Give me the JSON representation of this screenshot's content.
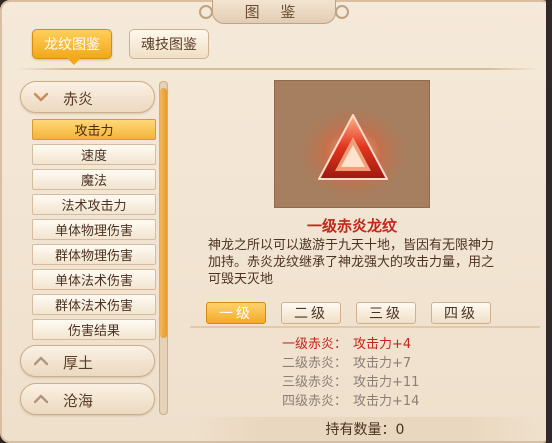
{
  "window": {
    "title": "图 鉴"
  },
  "tabs": [
    {
      "label": "龙纹图鉴",
      "active": true
    },
    {
      "label": "魂技图鉴",
      "active": false
    }
  ],
  "categories": [
    {
      "label": "赤炎",
      "expanded": true,
      "icon": "chevron-down-icon"
    },
    {
      "label": "厚土",
      "expanded": false,
      "icon": "chevron-up-icon"
    },
    {
      "label": "沧海",
      "expanded": false,
      "icon": "chevron-up-icon"
    }
  ],
  "sub_items": [
    {
      "label": "攻击力",
      "active": true
    },
    {
      "label": "速度",
      "active": false
    },
    {
      "label": "魔法",
      "active": false
    },
    {
      "label": "法术攻击力",
      "active": false
    },
    {
      "label": "单体物理伤害",
      "active": false
    },
    {
      "label": "群体物理伤害",
      "active": false
    },
    {
      "label": "单体法术伤害",
      "active": false
    },
    {
      "label": "群体法术伤害",
      "active": false
    },
    {
      "label": "伤害结果",
      "active": false
    }
  ],
  "detail": {
    "name": "一级赤炎龙纹",
    "description": "神龙之所以可以遨游于九天十地，皆因有无限神力加持。赤炎龙纹继承了神龙强大的攻击力量，用之可毁天灭地",
    "levels": [
      {
        "label": "一级",
        "active": true
      },
      {
        "label": "二级",
        "active": false
      },
      {
        "label": "三级",
        "active": false
      },
      {
        "label": "四级",
        "active": false
      }
    ],
    "attributes": [
      {
        "name": "一级赤炎：",
        "value": "攻击力+4",
        "active": true
      },
      {
        "name": "二级赤炎：",
        "value": "攻击力+7",
        "active": false
      },
      {
        "name": "三级赤炎：",
        "value": "攻击力+11",
        "active": false
      },
      {
        "name": "四级赤炎：",
        "value": "攻击力+14",
        "active": false
      }
    ],
    "owned": "持有数量：0"
  },
  "colors": {
    "accent_orange": "#f4aa2a",
    "highlight_red": "#c1271a",
    "panel_bg": "#f5e9d9"
  }
}
